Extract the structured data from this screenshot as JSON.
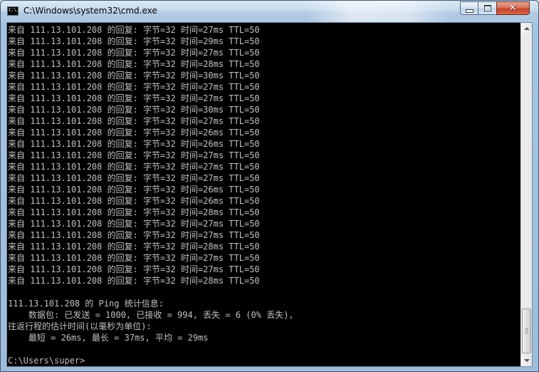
{
  "window": {
    "title": "C:\\Windows\\system32\\cmd.exe",
    "icon_glyph": "C:\\."
  },
  "title_controls": {
    "minimize_icon": "minimize-icon",
    "maximize_icon": "maximize-icon",
    "close_icon": "close-icon",
    "close_glyph": "✕"
  },
  "console": {
    "lines": [
      "来自 111.13.101.208 的回复: 字节=32 时间=27ms TTL=50",
      "来自 111.13.101.208 的回复: 字节=32 时间=29ms TTL=50",
      "来自 111.13.101.208 的回复: 字节=32 时间=27ms TTL=50",
      "来自 111.13.101.208 的回复: 字节=32 时间=28ms TTL=50",
      "来自 111.13.101.208 的回复: 字节=32 时间=30ms TTL=50",
      "来自 111.13.101.208 的回复: 字节=32 时间=27ms TTL=50",
      "来自 111.13.101.208 的回复: 字节=32 时间=27ms TTL=50",
      "来自 111.13.101.208 的回复: 字节=32 时间=30ms TTL=50",
      "来自 111.13.101.208 的回复: 字节=32 时间=27ms TTL=50",
      "来自 111.13.101.208 的回复: 字节=32 时间=26ms TTL=50",
      "来自 111.13.101.208 的回复: 字节=32 时间=26ms TTL=50",
      "来自 111.13.101.208 的回复: 字节=32 时间=27ms TTL=50",
      "来自 111.13.101.208 的回复: 字节=32 时间=27ms TTL=50",
      "来自 111.13.101.208 的回复: 字节=32 时间=27ms TTL=50",
      "来自 111.13.101.208 的回复: 字节=32 时间=26ms TTL=50",
      "来自 111.13.101.208 的回复: 字节=32 时间=26ms TTL=50",
      "来自 111.13.101.208 的回复: 字节=32 时间=28ms TTL=50",
      "来自 111.13.101.208 的回复: 字节=32 时间=27ms TTL=50",
      "来自 111.13.101.208 的回复: 字节=32 时间=27ms TTL=50",
      "来自 111.13.101.208 的回复: 字节=32 时间=28ms TTL=50",
      "来自 111.13.101.208 的回复: 字节=32 时间=27ms TTL=50",
      "来自 111.13.101.208 的回复: 字节=32 时间=27ms TTL=50",
      "来自 111.13.101.208 的回复: 字节=32 时间=28ms TTL=50",
      "",
      "111.13.101.208 的 Ping 统计信息:",
      "    数据包: 已发送 = 1000, 已接收 = 994, 丢失 = 6 (0% 丢失),",
      "往返行程的估计时间(以毫秒为单位):",
      "    最短 = 26ms, 最长 = 37ms, 平均 = 29ms",
      "",
      "C:\\Users\\super>"
    ]
  },
  "colors": {
    "console_bg": "#000000",
    "console_fg": "#c0c0c0",
    "close_button": "#c6432a"
  },
  "scrollbar": {
    "up_icon": "scroll-up-arrow-icon",
    "down_icon": "scroll-down-arrow-icon"
  }
}
